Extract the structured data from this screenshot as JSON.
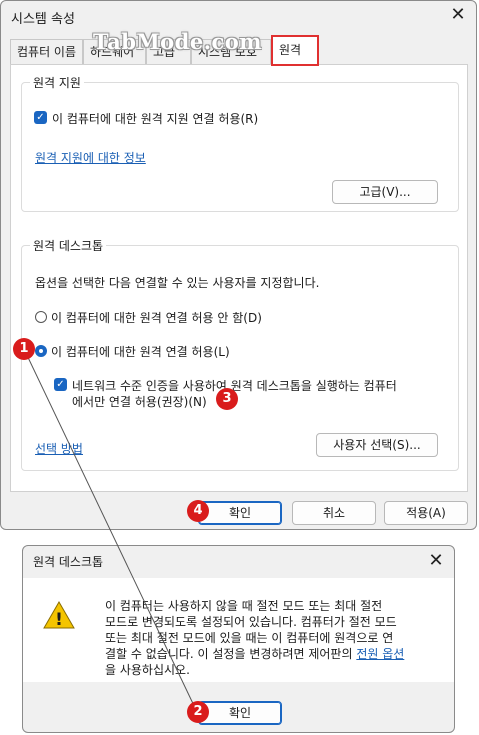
{
  "main_window": {
    "title": "시스템 속성",
    "close_glyph": "✕",
    "watermark": "TabMode.com",
    "tabs": [
      {
        "label": "컴퓨터 이름"
      },
      {
        "label": "하드웨어"
      },
      {
        "label": "고급"
      },
      {
        "label": "시스템 보호"
      },
      {
        "label": "원격"
      }
    ],
    "remote_assistance": {
      "legend": "원격 지원",
      "allow_checkbox_label": "이 컴퓨터에 대한 원격 지원 연결 허용(R)",
      "info_link": "원격 지원에 대한 정보",
      "advanced_button": "고급(V)..."
    },
    "remote_desktop": {
      "legend": "원격 데스크톱",
      "instruction": "옵션을 선택한 다음 연결할 수 있는 사용자를 지정합니다.",
      "radio_deny": "이 컴퓨터에 대한 원격 연결 허용 안 함(D)",
      "radio_allow": "이 컴퓨터에 대한 원격 연결 허용(L)",
      "nla_line1": "네트워크 수준 인증을 사용하여 원격 데스크톱을 실행하는 컴퓨터",
      "nla_line2": "에서만 연결 허용(권장)(N)",
      "help_link": "선택 방법",
      "select_users_button": "사용자 선택(S)..."
    },
    "buttons": {
      "ok": "확인",
      "cancel": "취소",
      "apply": "적용(A)"
    }
  },
  "dialog": {
    "title": "원격 데스크톱",
    "close_glyph": "✕",
    "warning_glyph": "!",
    "message_lines": [
      "이 컴퓨터는 사용하지 않을 때 절전 모드 또는 최대 절전",
      "모드로 변경되도록 설정되어 있습니다. 컴퓨터가 절전 모드",
      "또는 최대 절전 모드에 있을 때는 이 컴퓨터에 원격으로 연",
      "결할 수 없습니다. 이 설정을 변경하려면 제어판의 "
    ],
    "message_link": "전원 옵션",
    "message_tail": "을 사용하십시오.",
    "ok_button": "확인"
  },
  "annotations": [
    "1",
    "2",
    "3",
    "4"
  ],
  "colors": {
    "accent": "#1a66c2",
    "annotation_red": "#d91c1c",
    "link": "#1a5fb4"
  }
}
